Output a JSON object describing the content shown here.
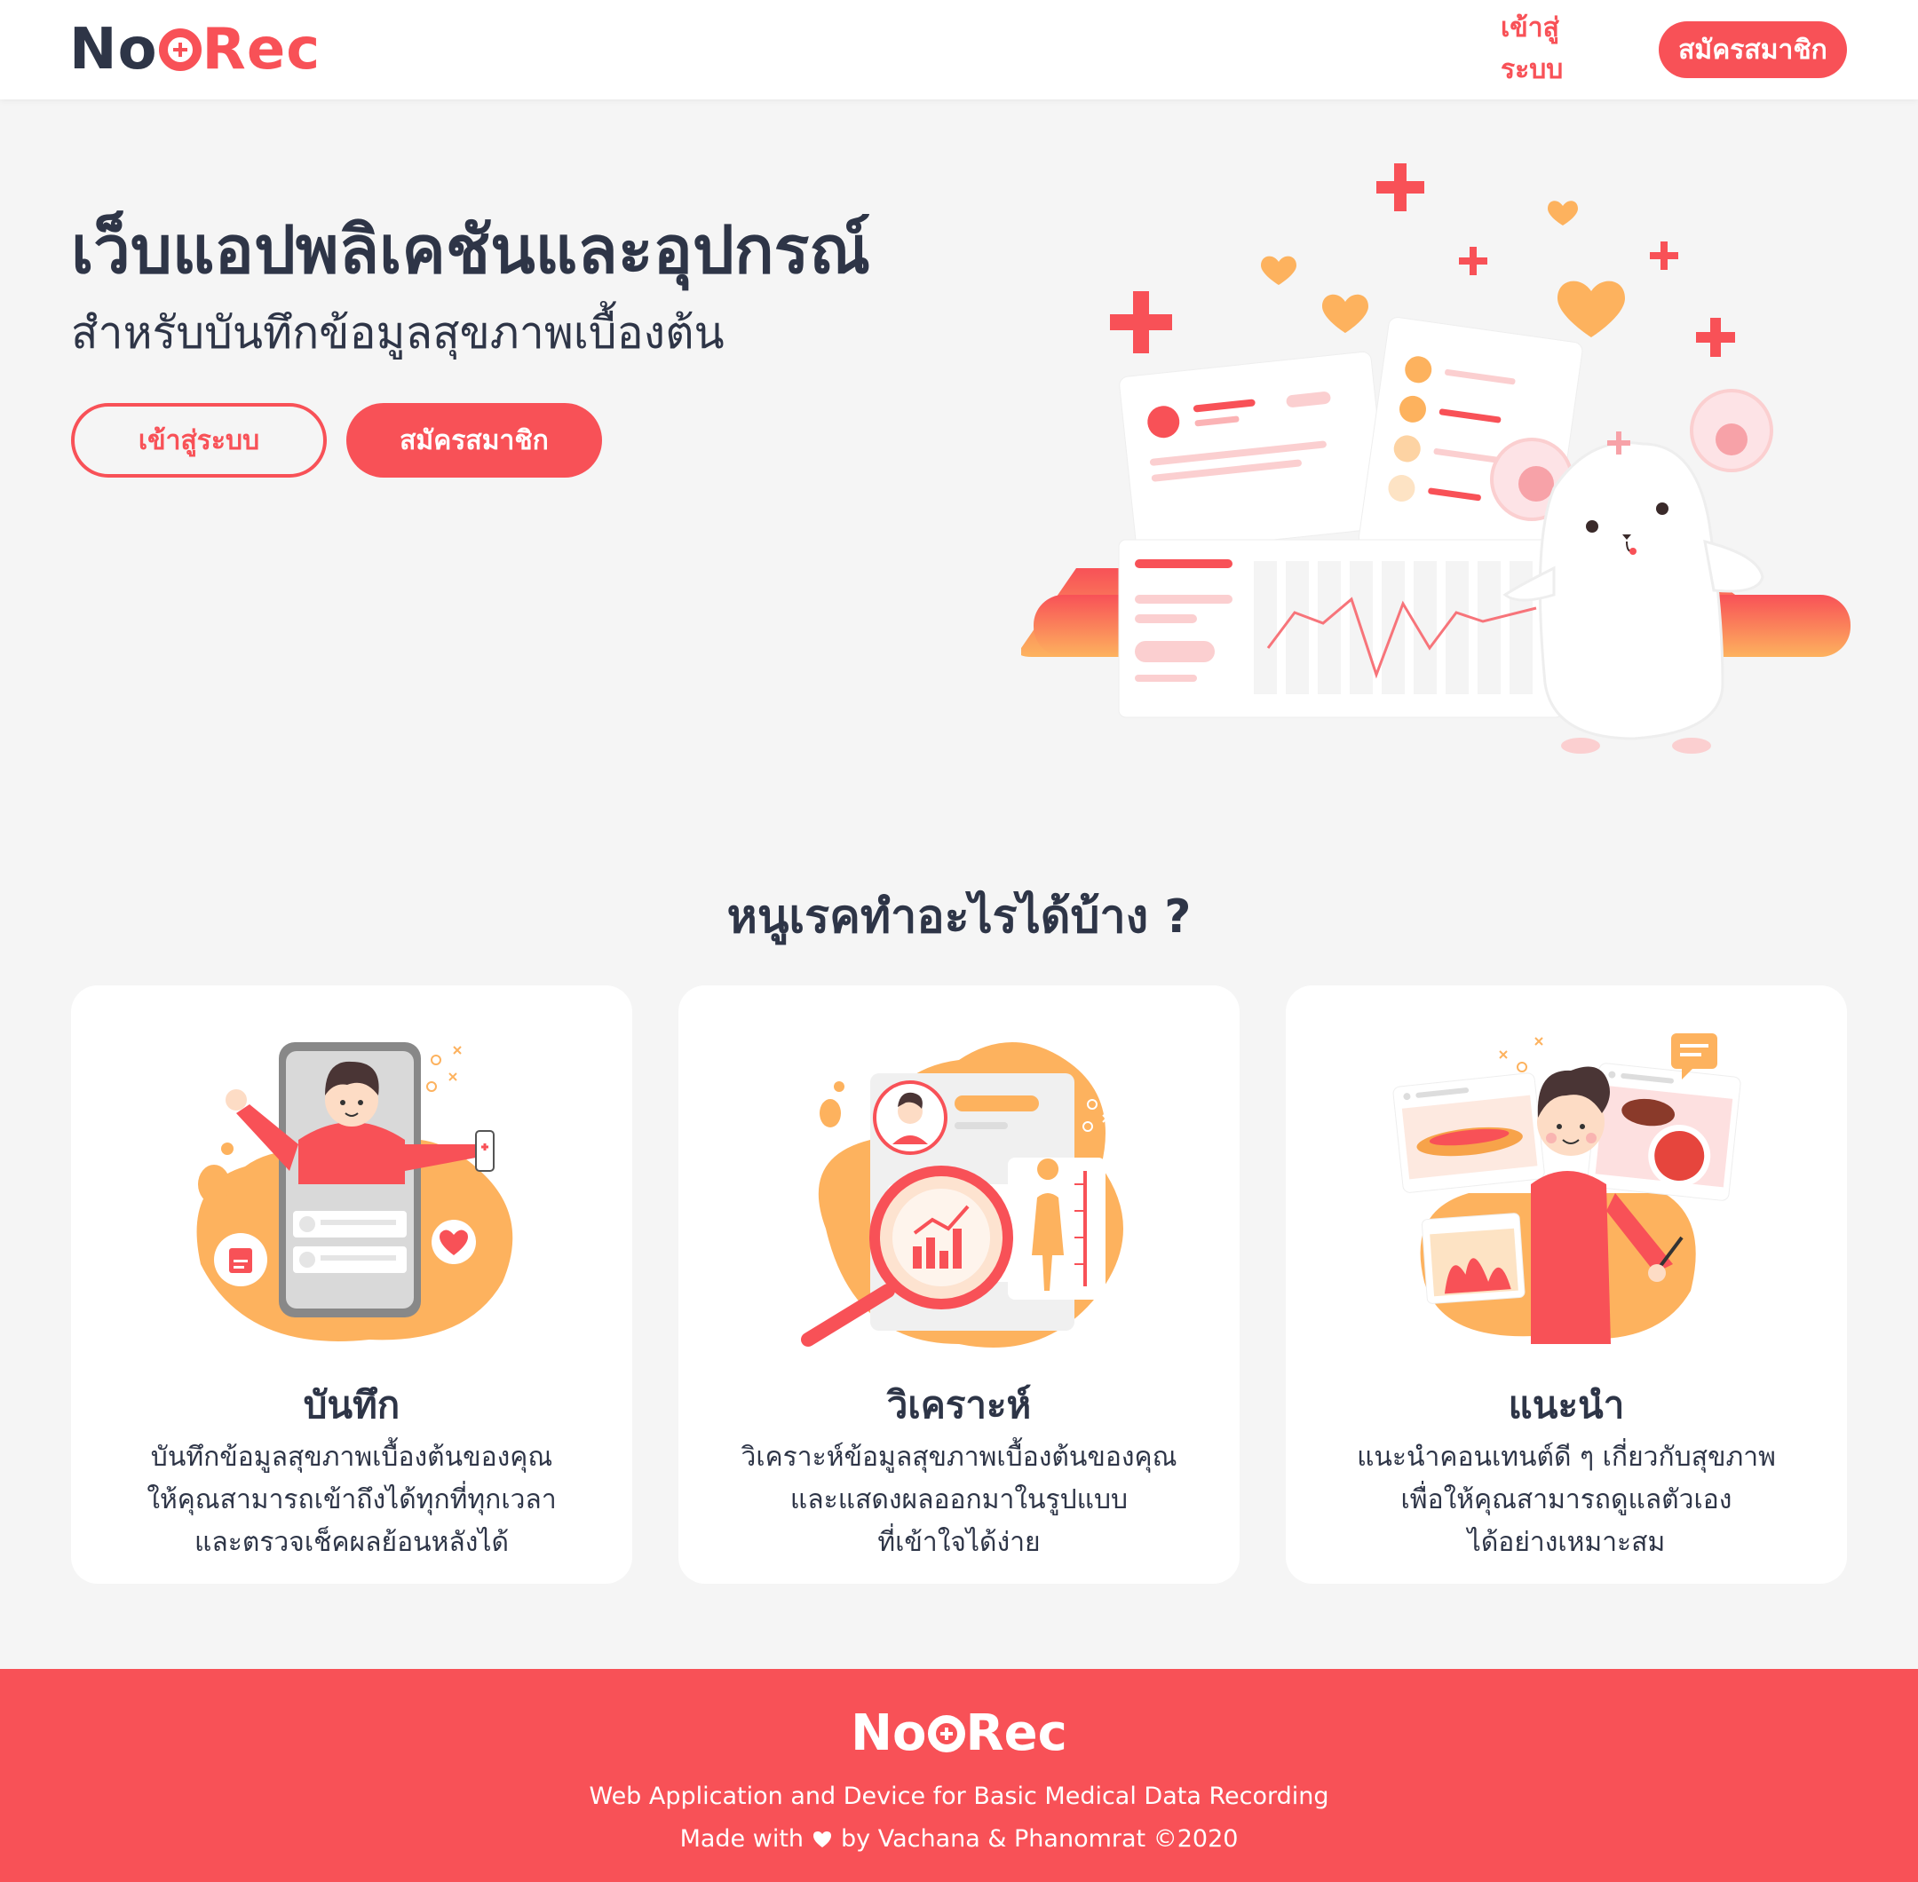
{
  "brand": {
    "logo_prefix": "No",
    "logo_suffix": "Rec",
    "primary_color": "#f85157",
    "accent_color": "#fdb25e",
    "text_color": "#2e3547"
  },
  "header": {
    "login_label": "เข้าสู่ระบบ",
    "signup_label": "สมัครสมาชิก"
  },
  "hero": {
    "title": "เว็บแอปพลิเคชันและอุปกรณ์",
    "subtitle": "สำหรับบันทึกข้อมูลสุขภาพเบื้องต้น",
    "login_label": "เข้าสู่ระบบ",
    "signup_label": "สมัครสมาชิก"
  },
  "features": {
    "title": "หนูเรคทำอะไรได้บ้าง ?",
    "cards": [
      {
        "title": "บันทึก",
        "lines": [
          "บันทึกข้อมูลสุขภาพเบื้องต้นของคุณ",
          "ให้คุณสามารถเข้าถึงได้ทุกที่ทุกเวลา",
          "และตรวจเช็คผลย้อนหลังได้"
        ],
        "icon": "phone-record-illustration"
      },
      {
        "title": "วิเคราะห์",
        "lines": [
          "วิเคราะห์ข้อมูลสุขภาพเบื้องต้นของคุณ",
          "และแสดงผลออกมาในรูปแบบ",
          "ที่เข้าใจได้ง่าย"
        ],
        "icon": "analysis-magnifier-illustration"
      },
      {
        "title": "แนะนำ",
        "lines": [
          "แนะนำคอนเทนต์ดี ๆ เกี่ยวกับสุขภาพ",
          "เพื่อให้คุณสามารถดูแลตัวเอง",
          "ได้อย่างเหมาะสม"
        ],
        "icon": "content-recommend-illustration"
      }
    ]
  },
  "footer": {
    "logo_prefix": "No",
    "logo_suffix": "Rec",
    "tagline": "Web Application and Device for Basic Medical Data Recording",
    "credit_prefix": "Made with",
    "credit_suffix": "by Vachana & Phanomrat ©2020"
  }
}
